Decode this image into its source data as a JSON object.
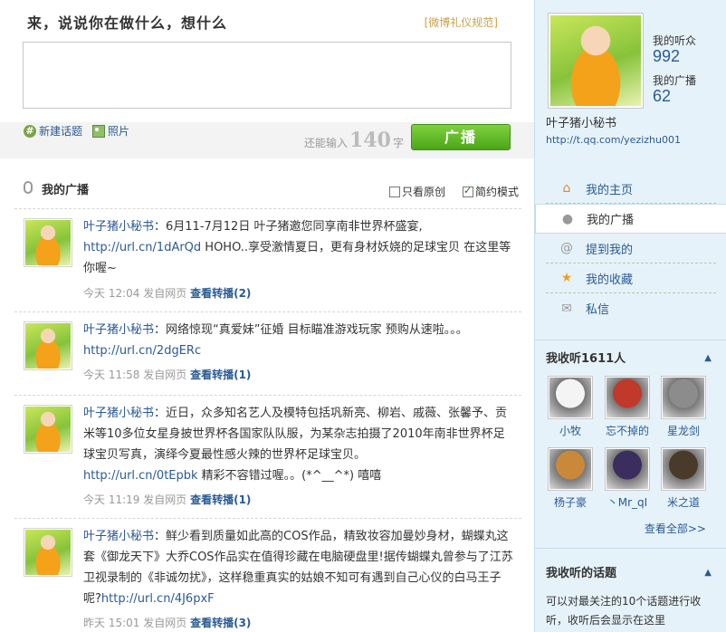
{
  "compose": {
    "title": "来，说说你在做什么，想什么",
    "etiquette_link": "[微博礼仪规范]",
    "tools": {
      "topic": "新建话题",
      "photo": "照片"
    },
    "counter_prefix": "还能输入",
    "counter_value": "140",
    "counter_suffix": "字",
    "broadcast_button": "广播"
  },
  "feed": {
    "title": "我的广播",
    "filters": {
      "original_only": "只看原创",
      "simple_mode": "简约模式"
    },
    "filter_state": {
      "original_only": false,
      "simple_mode": true
    },
    "posts": [
      {
        "author": "叶子猪小秘书",
        "text_a": "：6月11-7月12日 叶子猪邀您同享南非世界杯盛宴,",
        "link": "http://url.cn/1dArQd",
        "text_b": " HOHO..享受激情夏日，更有身材妖娆的足球宝贝 在这里等你喔~",
        "time": "今天 12:04",
        "source": "发自网页",
        "repost": "查看转播(2)"
      },
      {
        "author": "叶子猪小秘书",
        "text_a": "：网络惊现“真爱妹”征婚 目标瞄准游戏玩家 预购从速啦。。。",
        "link": "http://url.cn/2dgERc",
        "text_b": "",
        "time": "今天 11:58",
        "source": "发自网页",
        "repost": "查看转播(1)"
      },
      {
        "author": "叶子猪小秘书",
        "text_a": "：近日，众多知名艺人及模特包括巩新亮、柳岩、戚薇、张馨予、贡米等10多位女星身披世界杯各国家队队服，为某杂志拍摄了2010年南非世界杯足球宝贝写真，演绎今夏最性感火辣的世界杯足球宝贝。",
        "link": "http://url.cn/0tEpbk",
        "text_b": " 精彩不容错过喔。。(*^__^*) 嘻嘻",
        "time": "今天 11:19",
        "source": "发自网页",
        "repost": "查看转播(1)"
      },
      {
        "author": "叶子猪小秘书",
        "text_a": "：鲜少看到质量如此高的COS作品，精致妆容加曼妙身材，蝴蝶丸这套《御龙天下》大乔COS作品实在值得珍藏在电脑硬盘里!据传蝴蝶丸曾参与了江苏卫视录制的《非诚勿扰》，这样稳重真实的姑娘不知可有遇到自己心仪的白马王子呢?",
        "link": "http://url.cn/4J6pxF",
        "text_b": "",
        "time": "昨天 15:01",
        "source": "发自网页",
        "repost": "查看转播(3)"
      }
    ]
  },
  "profile": {
    "listeners_label": "我的听众",
    "listeners_count": "992",
    "broadcasts_label": "我的广播",
    "broadcasts_count": "62",
    "username": "叶子猪小秘书",
    "url": "http://t.qq.com/yezizhu001"
  },
  "nav": [
    {
      "label": "我的主页",
      "icon": "home-icon",
      "active": false
    },
    {
      "label": "我的广播",
      "icon": "microphone-icon",
      "active": true
    },
    {
      "label": "提到我的",
      "icon": "at-icon",
      "active": false
    },
    {
      "label": "我的收藏",
      "icon": "star-icon",
      "active": false
    },
    {
      "label": "私信",
      "icon": "envelope-icon",
      "active": false
    }
  ],
  "following": {
    "title": "我收听1611人",
    "users": [
      {
        "name": "小牧",
        "color": "#f4f4f4"
      },
      {
        "name": "忘不掉的",
        "color": "#c0392b"
      },
      {
        "name": "星龙剑",
        "color": "#8c8c8c"
      },
      {
        "name": "杨子豪",
        "color": "#c9883a"
      },
      {
        "name": "丶Mr_qI",
        "color": "#3b2d5e"
      },
      {
        "name": "米之道",
        "color": "#4a3a2a"
      }
    ],
    "see_all": "查看全部>>"
  },
  "topics": {
    "title": "我收听的话题",
    "description": "可以对最关注的10个话题进行收听，收听后会显示在这里"
  }
}
